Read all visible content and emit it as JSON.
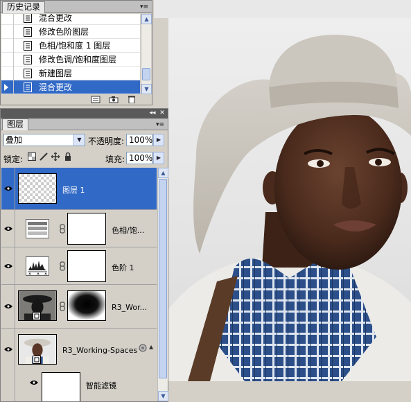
{
  "history": {
    "tab_label": "历史记录",
    "items": [
      {
        "label": "混合更改",
        "selected": false
      },
      {
        "label": "修改色阶图层",
        "selected": false
      },
      {
        "label": "色相/饱和度 1 图层",
        "selected": false
      },
      {
        "label": "修改色调/饱和度图层",
        "selected": false
      },
      {
        "label": "新建图层",
        "selected": false
      },
      {
        "label": "混合更改",
        "selected": true
      }
    ],
    "footer_icons": [
      "new-document-from-state-icon",
      "snapshot-camera-icon",
      "trash-icon"
    ]
  },
  "layers": {
    "tab_label": "图层",
    "blend_mode": "叠加",
    "opacity_label": "不透明度:",
    "opacity_value": "100%",
    "lock_label": "锁定:",
    "fill_label": "填充:",
    "fill_value": "100%",
    "lock_icons": [
      "lock-transparent-icon",
      "lock-paint-icon",
      "lock-move-icon",
      "lock-all-icon"
    ],
    "items": [
      {
        "name": "图层 1",
        "kind": "pixel",
        "selected": true
      },
      {
        "name": "色相/饱...",
        "kind": "hue-saturation-adjustment",
        "selected": false
      },
      {
        "name": "色阶 1",
        "kind": "levels-adjustment",
        "selected": false
      },
      {
        "name": "R3_Wor...",
        "kind": "smart-object-with-mask",
        "selected": false
      },
      {
        "name": "R3_Working-Spaces",
        "kind": "smart-object",
        "selected": false
      }
    ],
    "smart_filters_label": "智能滤镜"
  },
  "colors": {
    "selection": "#3169c6",
    "panel": "#d4d0c8"
  }
}
